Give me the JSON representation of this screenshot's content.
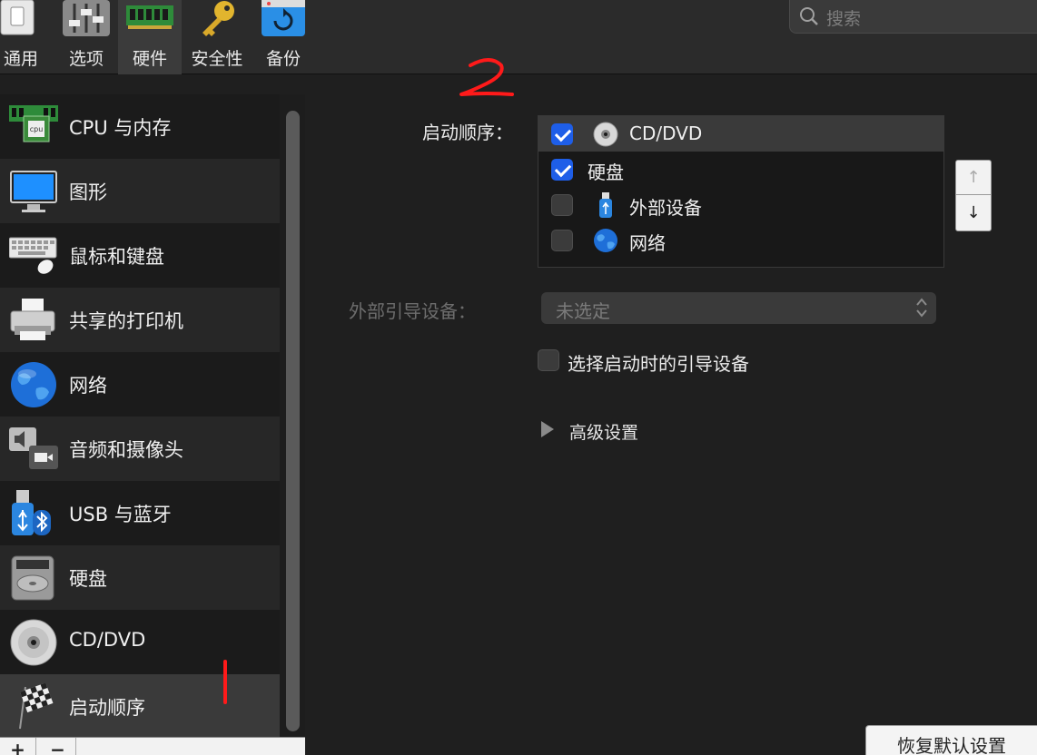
{
  "toolbar": {
    "items": [
      {
        "label": "通用",
        "icon": "switch-icon"
      },
      {
        "label": "选项",
        "icon": "sliders-icon"
      },
      {
        "label": "硬件",
        "icon": "ram-chip-icon"
      },
      {
        "label": "安全性",
        "icon": "key-icon"
      },
      {
        "label": "备份",
        "icon": "backup-icon"
      }
    ],
    "active": "硬件",
    "search_placeholder": "搜索"
  },
  "sidebar": {
    "items": [
      {
        "label": "CPU 与内存",
        "icon": "cpu-memory-icon"
      },
      {
        "label": "图形",
        "icon": "monitor-icon"
      },
      {
        "label": "鼠标和键盘",
        "icon": "keyboard-mouse-icon"
      },
      {
        "label": "共享的打印机",
        "icon": "printer-icon"
      },
      {
        "label": "网络",
        "icon": "globe-icon"
      },
      {
        "label": "音频和摄像头",
        "icon": "audio-camera-icon"
      },
      {
        "label": "USB 与蓝牙",
        "icon": "usb-bluetooth-icon"
      },
      {
        "label": "硬盘",
        "icon": "hard-disk-icon"
      },
      {
        "label": "CD/DVD",
        "icon": "cd-dvd-icon"
      },
      {
        "label": "启动顺序",
        "icon": "checkered-flag-icon"
      }
    ],
    "selected": "启动顺序",
    "add_label": "+",
    "remove_label": "−"
  },
  "annotations": {
    "one": "1",
    "two": "2"
  },
  "boot": {
    "label": "启动顺序：",
    "items": [
      {
        "label": "CD/DVD",
        "checked": true,
        "icon": "cd-dvd-icon"
      },
      {
        "label": "硬盘",
        "checked": true,
        "icon": ""
      },
      {
        "label": "外部设备",
        "checked": false,
        "icon": "usb-drive-icon"
      },
      {
        "label": "网络",
        "checked": false,
        "icon": "globe-icon"
      }
    ],
    "move_up": "↑",
    "move_down": "↓"
  },
  "external_boot": {
    "label": "外部引导设备：",
    "value": "未选定"
  },
  "choose_at_startup": {
    "label": "选择启动时的引导设备",
    "checked": false
  },
  "advanced": {
    "label": "高级设置"
  },
  "restore_button": "恢复默认设置",
  "colors": {
    "accent": "#1e5ee8",
    "annotation": "#ff1a1a",
    "background": "#1f1f1f"
  }
}
